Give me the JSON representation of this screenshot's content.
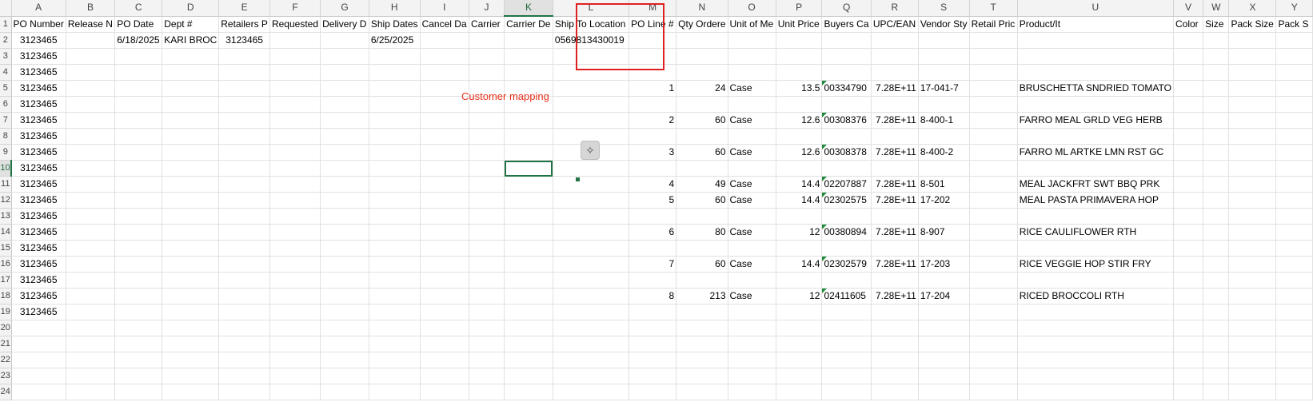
{
  "sheet": {
    "columns": [
      {
        "letter": "A",
        "header": "PO Number"
      },
      {
        "letter": "B",
        "header": "Release N"
      },
      {
        "letter": "C",
        "header": "PO Date"
      },
      {
        "letter": "D",
        "header": "Dept #"
      },
      {
        "letter": "E",
        "header": "Retailers P"
      },
      {
        "letter": "F",
        "header": "Requested"
      },
      {
        "letter": "G",
        "header": "Delivery D"
      },
      {
        "letter": "H",
        "header": "Ship Dates"
      },
      {
        "letter": "I",
        "header": "Cancel Da"
      },
      {
        "letter": "J",
        "header": "Carrier"
      },
      {
        "letter": "K",
        "header": "Carrier De"
      },
      {
        "letter": "L",
        "header": "Ship To Location"
      },
      {
        "letter": "M",
        "header": "PO Line #"
      },
      {
        "letter": "N",
        "header": "Qty Ordere"
      },
      {
        "letter": "O",
        "header": "Unit of Me"
      },
      {
        "letter": "P",
        "header": "Unit Price"
      },
      {
        "letter": "Q",
        "header": "Buyers Ca"
      },
      {
        "letter": "R",
        "header": "UPC/EAN"
      },
      {
        "letter": "S",
        "header": "Vendor Sty"
      },
      {
        "letter": "T",
        "header": "Retail Pric"
      },
      {
        "letter": "U",
        "header": "Product/It"
      },
      {
        "letter": "V",
        "header": "Color"
      },
      {
        "letter": "W",
        "header": "Size"
      },
      {
        "letter": "X",
        "header": "Pack Size"
      },
      {
        "letter": "Y",
        "header": "Pack S"
      }
    ],
    "row_numbers": [
      "1",
      "2",
      "3",
      "4",
      "5",
      "6",
      "7",
      "8",
      "9",
      "10",
      "11",
      "12",
      "13",
      "14",
      "15",
      "16",
      "17",
      "18",
      "19",
      "20",
      "21",
      "22",
      "23",
      "24"
    ],
    "header_row": {
      "A": "PO Number",
      "B": "Release N",
      "C": "PO Date",
      "D": "Dept #",
      "E": "Retailers P",
      "F": "Requested",
      "G": "Delivery D",
      "H": "Ship Dates",
      "I": "Cancel Da",
      "J": "Carrier",
      "K": "Carrier De",
      "L": "Ship To Location",
      "M": "PO Line #",
      "N": "Qty Ordere",
      "O": "Unit of Me",
      "P": "Unit Price",
      "Q": "Buyers Ca",
      "R": "UPC/EAN",
      "S": "Vendor Sty",
      "T": "Retail Pric",
      "U": "Product/It",
      "V": "Color",
      "W": "Size",
      "X": "Pack Size",
      "Y": "Pack S"
    },
    "row2": {
      "A": "3123465",
      "C": "6/18/2025",
      "D": "KARI BROC",
      "E": "3123465",
      "H": "6/25/2025",
      "L": "0569813430019"
    },
    "po_number": "3123465",
    "lines": [
      {
        "row": 5,
        "line": "1",
        "qty": "24",
        "uom": "Case",
        "price": "13.5",
        "buyer": "00334790",
        "upc": "7.28E+11",
        "style": "17-041-7",
        "product": "BRUSCHETTA SNDRIED TOMATO"
      },
      {
        "row": 7,
        "line": "2",
        "qty": "60",
        "uom": "Case",
        "price": "12.6",
        "buyer": "00308376",
        "upc": "7.28E+11",
        "style": "8-400-1",
        "product": "FARRO MEAL GRLD VEG  HERB"
      },
      {
        "row": 9,
        "line": "3",
        "qty": "60",
        "uom": "Case",
        "price": "12.6",
        "buyer": "00308378",
        "upc": "7.28E+11",
        "style": "8-400-2",
        "product": "FARRO ML ARTKE LMN RST GC"
      },
      {
        "row": 11,
        "line": "4",
        "qty": "49",
        "uom": "Case",
        "price": "14.4",
        "buyer": "02207887",
        "upc": "7.28E+11",
        "style": "8-501",
        "product": "MEAL JACKFRT SWT BBQ PRK"
      },
      {
        "row": 12,
        "line": "5",
        "qty": "60",
        "uom": "Case",
        "price": "14.4",
        "buyer": "02302575",
        "upc": "7.28E+11",
        "style": "17-202",
        "product": "MEAL PASTA PRIMAVERA HOP"
      },
      {
        "row": 14,
        "line": "6",
        "qty": "80",
        "uom": "Case",
        "price": "12",
        "buyer": "00380894",
        "upc": "7.28E+11",
        "style": "8-907",
        "product": "RICE CAULIFLOWER RTH"
      },
      {
        "row": 16,
        "line": "7",
        "qty": "60",
        "uom": "Case",
        "price": "14.4",
        "buyer": "02302579",
        "upc": "7.28E+11",
        "style": "17-203",
        "product": "RICE VEGGIE HOP STIR FRY"
      },
      {
        "row": 18,
        "line": "8",
        "qty": "213",
        "uom": "Case",
        "price": "12",
        "buyer": "02411605",
        "upc": "7.28E+11",
        "style": "17-204",
        "product": "RICED BROCCOLI RTH"
      }
    ],
    "selected_cell": "K10",
    "selected_column": "K",
    "selected_row": "10"
  },
  "annotation": {
    "text": "Customer mapping",
    "color": "#e8321e",
    "box_color": "#e02020"
  },
  "floating_button": {
    "icon": "magic-wand-sparkle-icon",
    "glyph": "✧"
  }
}
